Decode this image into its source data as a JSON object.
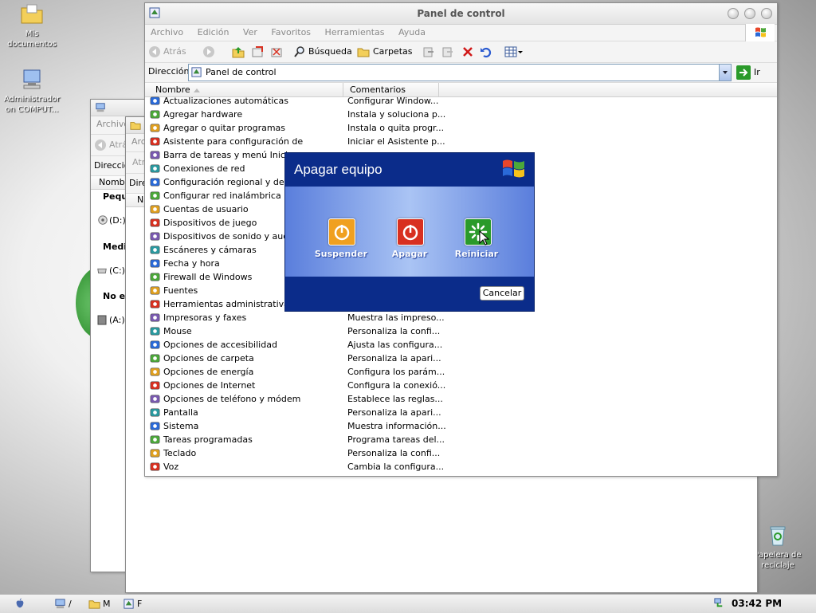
{
  "desktop": {
    "icons": [
      {
        "label": "Mis documentos"
      },
      {
        "label": "Administrador on COMPUT..."
      },
      {
        "label": "Papelera de reciclaje"
      }
    ]
  },
  "back_window_1": {
    "menu_label": "Archivo",
    "back_label": "Atrás",
    "address_label": "Dirección",
    "col_header": "Nombre",
    "group_1": "Pequ",
    "drive_d": "(D:)",
    "group_2": "Medi",
    "drive_c": "(C:)",
    "group_3": "No es",
    "drive_a": "(A:)"
  },
  "back_window_2": {
    "menu_label": "Arc",
    "back_label": "Atr",
    "address_label": "Dire",
    "col_header": "N"
  },
  "main_window": {
    "title": "Panel de control",
    "menu": [
      "Archivo",
      "Edición",
      "Ver",
      "Favoritos",
      "Herramientas",
      "Ayuda"
    ],
    "toolbar": {
      "back": "Atrás",
      "search": "Búsqueda",
      "folders": "Carpetas"
    },
    "address": {
      "label": "Dirección",
      "value": "Panel de control",
      "go": "Ir"
    },
    "columns": {
      "name": "Nombre",
      "comments": "Comentarios"
    },
    "items": [
      {
        "name": "Actualizaciones automáticas",
        "comment": "Configurar Window..."
      },
      {
        "name": "Agregar hardware",
        "comment": "Instala y soluciona p..."
      },
      {
        "name": "Agregar o quitar programas",
        "comment": "Instala o quita progr..."
      },
      {
        "name": "Asistente para configuración de",
        "comment": "Iniciar el Asistente p..."
      },
      {
        "name": "Barra de tareas y menú Inicio",
        "comment": ""
      },
      {
        "name": "Conexiones de red",
        "comment": ""
      },
      {
        "name": "Configuración regional y de idio",
        "comment": ""
      },
      {
        "name": "Configurar red inalámbrica",
        "comment": ""
      },
      {
        "name": "Cuentas de usuario",
        "comment": ""
      },
      {
        "name": "Dispositivos de juego",
        "comment": ""
      },
      {
        "name": "Dispositivos de sonido y audio",
        "comment": ""
      },
      {
        "name": "Escáneres y cámaras",
        "comment": ""
      },
      {
        "name": "Fecha y hora",
        "comment": ""
      },
      {
        "name": "Firewall de Windows",
        "comment": ""
      },
      {
        "name": "Fuentes",
        "comment": ""
      },
      {
        "name": "Herramientas administrativas",
        "comment": ""
      },
      {
        "name": "Impresoras y faxes",
        "comment": "Muestra las impreso..."
      },
      {
        "name": "Mouse",
        "comment": "Personaliza la confi..."
      },
      {
        "name": "Opciones de accesibilidad",
        "comment": "Ajusta las configura..."
      },
      {
        "name": "Opciones de carpeta",
        "comment": "Personaliza la apari..."
      },
      {
        "name": "Opciones de energía",
        "comment": "Configura los parám..."
      },
      {
        "name": "Opciones de Internet",
        "comment": "Configura la conexió..."
      },
      {
        "name": "Opciones de teléfono y módem",
        "comment": "Establece las reglas..."
      },
      {
        "name": "Pantalla",
        "comment": "Personaliza la apari..."
      },
      {
        "name": "Sistema",
        "comment": "Muestra información..."
      },
      {
        "name": "Tareas programadas",
        "comment": "Programa tareas del..."
      },
      {
        "name": "Teclado",
        "comment": "Personaliza la confi..."
      },
      {
        "name": "Voz",
        "comment": "Cambia la configura..."
      }
    ]
  },
  "shutdown_dialog": {
    "title": "Apagar equipo",
    "suspend": "Suspender",
    "shutdown": "Apagar",
    "restart": "Reiniciar",
    "cancel": "Cancelar",
    "colors": {
      "suspend": "#f0a020",
      "shutdown": "#d83020",
      "restart": "#2a9a2a"
    }
  },
  "taskbar": {
    "tasks": [
      "/",
      "M",
      "F"
    ],
    "clock": "03:42 PM"
  },
  "icons": [
    "folder-icon",
    "computer-icon",
    "recycle-bin-icon",
    "back-arrow-icon",
    "forward-arrow-icon",
    "up-folder-icon",
    "search-icon",
    "folders-icon",
    "delete-icon",
    "undo-icon",
    "views-icon",
    "go-arrow-icon",
    "power-icon",
    "windows-logo-icon",
    "mouse-cursor-icon",
    "apple-icon"
  ]
}
